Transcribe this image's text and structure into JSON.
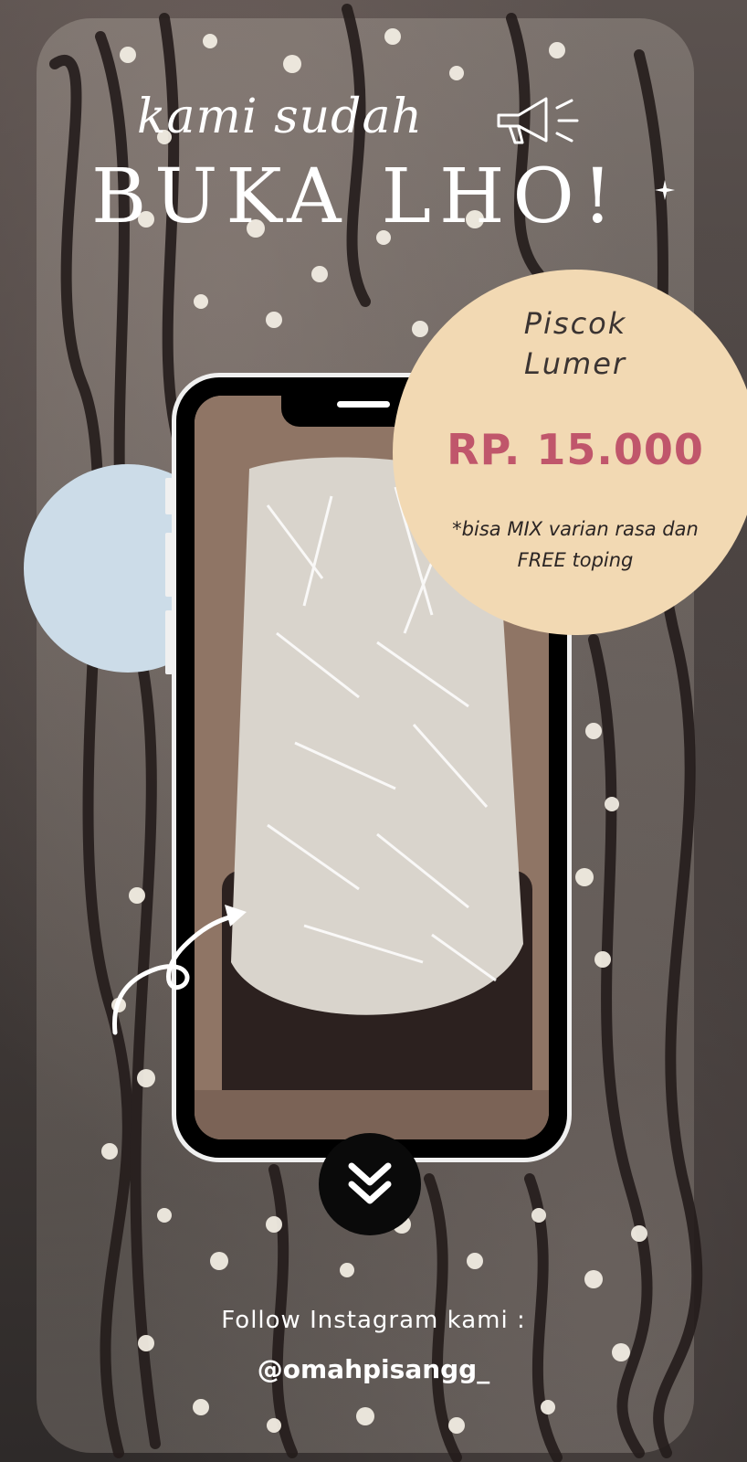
{
  "headline": {
    "line1": "kami sudah",
    "line2": "BUKA LHO!"
  },
  "product": {
    "name_line1": "Piscok",
    "name_line2": "Lumer",
    "price": "RP. 15.000",
    "note_line1": "*bisa MIX varian rasa dan",
    "note_line2": "FREE toping"
  },
  "footer": {
    "follow_label": "Follow Instagram kami :",
    "instagram_handle": "@omahpisangg_"
  },
  "icons": {
    "megaphone": "megaphone-icon",
    "sparkle": "sparkle-icon",
    "arrow": "curved-arrow-icon",
    "scroll_down": "double-chevron-down-icon"
  },
  "colors": {
    "price_circle": "#f2d9b3",
    "price_text": "#c0566b",
    "accent_circle": "#ccdce8",
    "phone_frame": "#000000"
  }
}
